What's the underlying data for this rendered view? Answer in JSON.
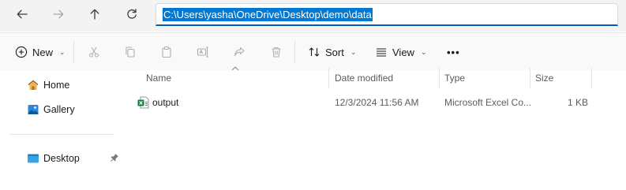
{
  "address_bar": {
    "path": "C:\\Users\\yasha\\OneDrive\\Desktop\\demo\\data"
  },
  "nav_buttons": {
    "back": "back-arrow-icon",
    "forward": "forward-arrow-icon",
    "up": "up-arrow-icon",
    "refresh": "refresh-icon"
  },
  "toolbar": {
    "new_label": "New",
    "sort_label": "Sort",
    "view_label": "View",
    "more_label": "•••"
  },
  "sidebar": {
    "items": [
      {
        "label": "Home",
        "icon": "home-icon"
      },
      {
        "label": "Gallery",
        "icon": "gallery-icon"
      },
      {
        "label": "Desktop",
        "icon": "desktop-folder-icon",
        "pinned": true
      }
    ]
  },
  "file_list": {
    "columns": [
      "Name",
      "Date modified",
      "Type",
      "Size"
    ],
    "sort_column": "Name",
    "rows": [
      {
        "name": "output",
        "date_modified": "12/3/2024 11:56 AM",
        "type": "Microsoft Excel Co...",
        "size": "1 KB",
        "icon": "excel-csv-icon"
      }
    ]
  },
  "colors": {
    "accent": "#0078d4",
    "excel_green": "#107c41"
  }
}
